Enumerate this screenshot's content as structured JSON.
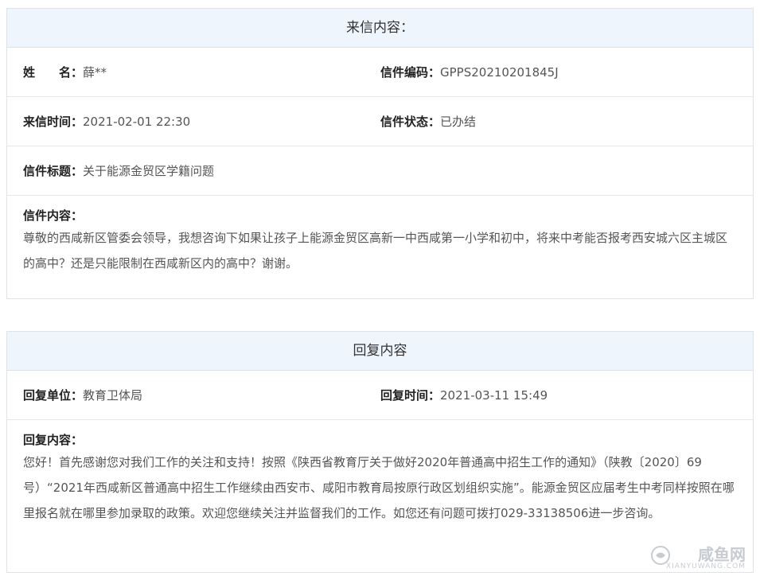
{
  "letter": {
    "header": "来信内容：",
    "name_label": "姓　　名：",
    "name_value": "薛**",
    "code_label": "信件编码：",
    "code_value": "GPPS20210201845J",
    "time_label": "来信时间：",
    "time_value": "2021-02-01 22:30",
    "status_label": "信件状态：",
    "status_value": "已办结",
    "title_label": "信件标题：",
    "title_value": "关于能源金贸区学籍问题",
    "content_label": "信件内容：",
    "content_value": "尊敬的西咸新区管委会领导，我想咨询下如果让孩子上能源金贸区高新一中西咸第一小学和初中，将来中考能否报考西安城六区主城区的高中？还是只能限制在西咸新区内的高中？谢谢。"
  },
  "reply": {
    "header": "回复内容",
    "unit_label": "回复单位：",
    "unit_value": "教育卫体局",
    "time_label": "回复时间：",
    "time_value": "2021-03-11 15:49",
    "content_label": "回复内容：",
    "content_value": "您好！首先感谢您对我们工作的关注和支持！按照《陕西省教育厅关于做好2020年普通高中招生工作的通知》（陕教〔2020〕69号）“2021年西咸新区普通高中招生工作继续由西安市、咸阳市教育局按原行政区划组织实施”。能源金贸区应届考生中考同样按照在哪里报名就在哪里参加录取的政策。欢迎您继续关注并监督我们的工作。如您还有问题可拨打029-33138506进一步咨询。"
  },
  "watermark": {
    "main": "咸鱼网",
    "sub": "XIANYUWANG.COM"
  }
}
